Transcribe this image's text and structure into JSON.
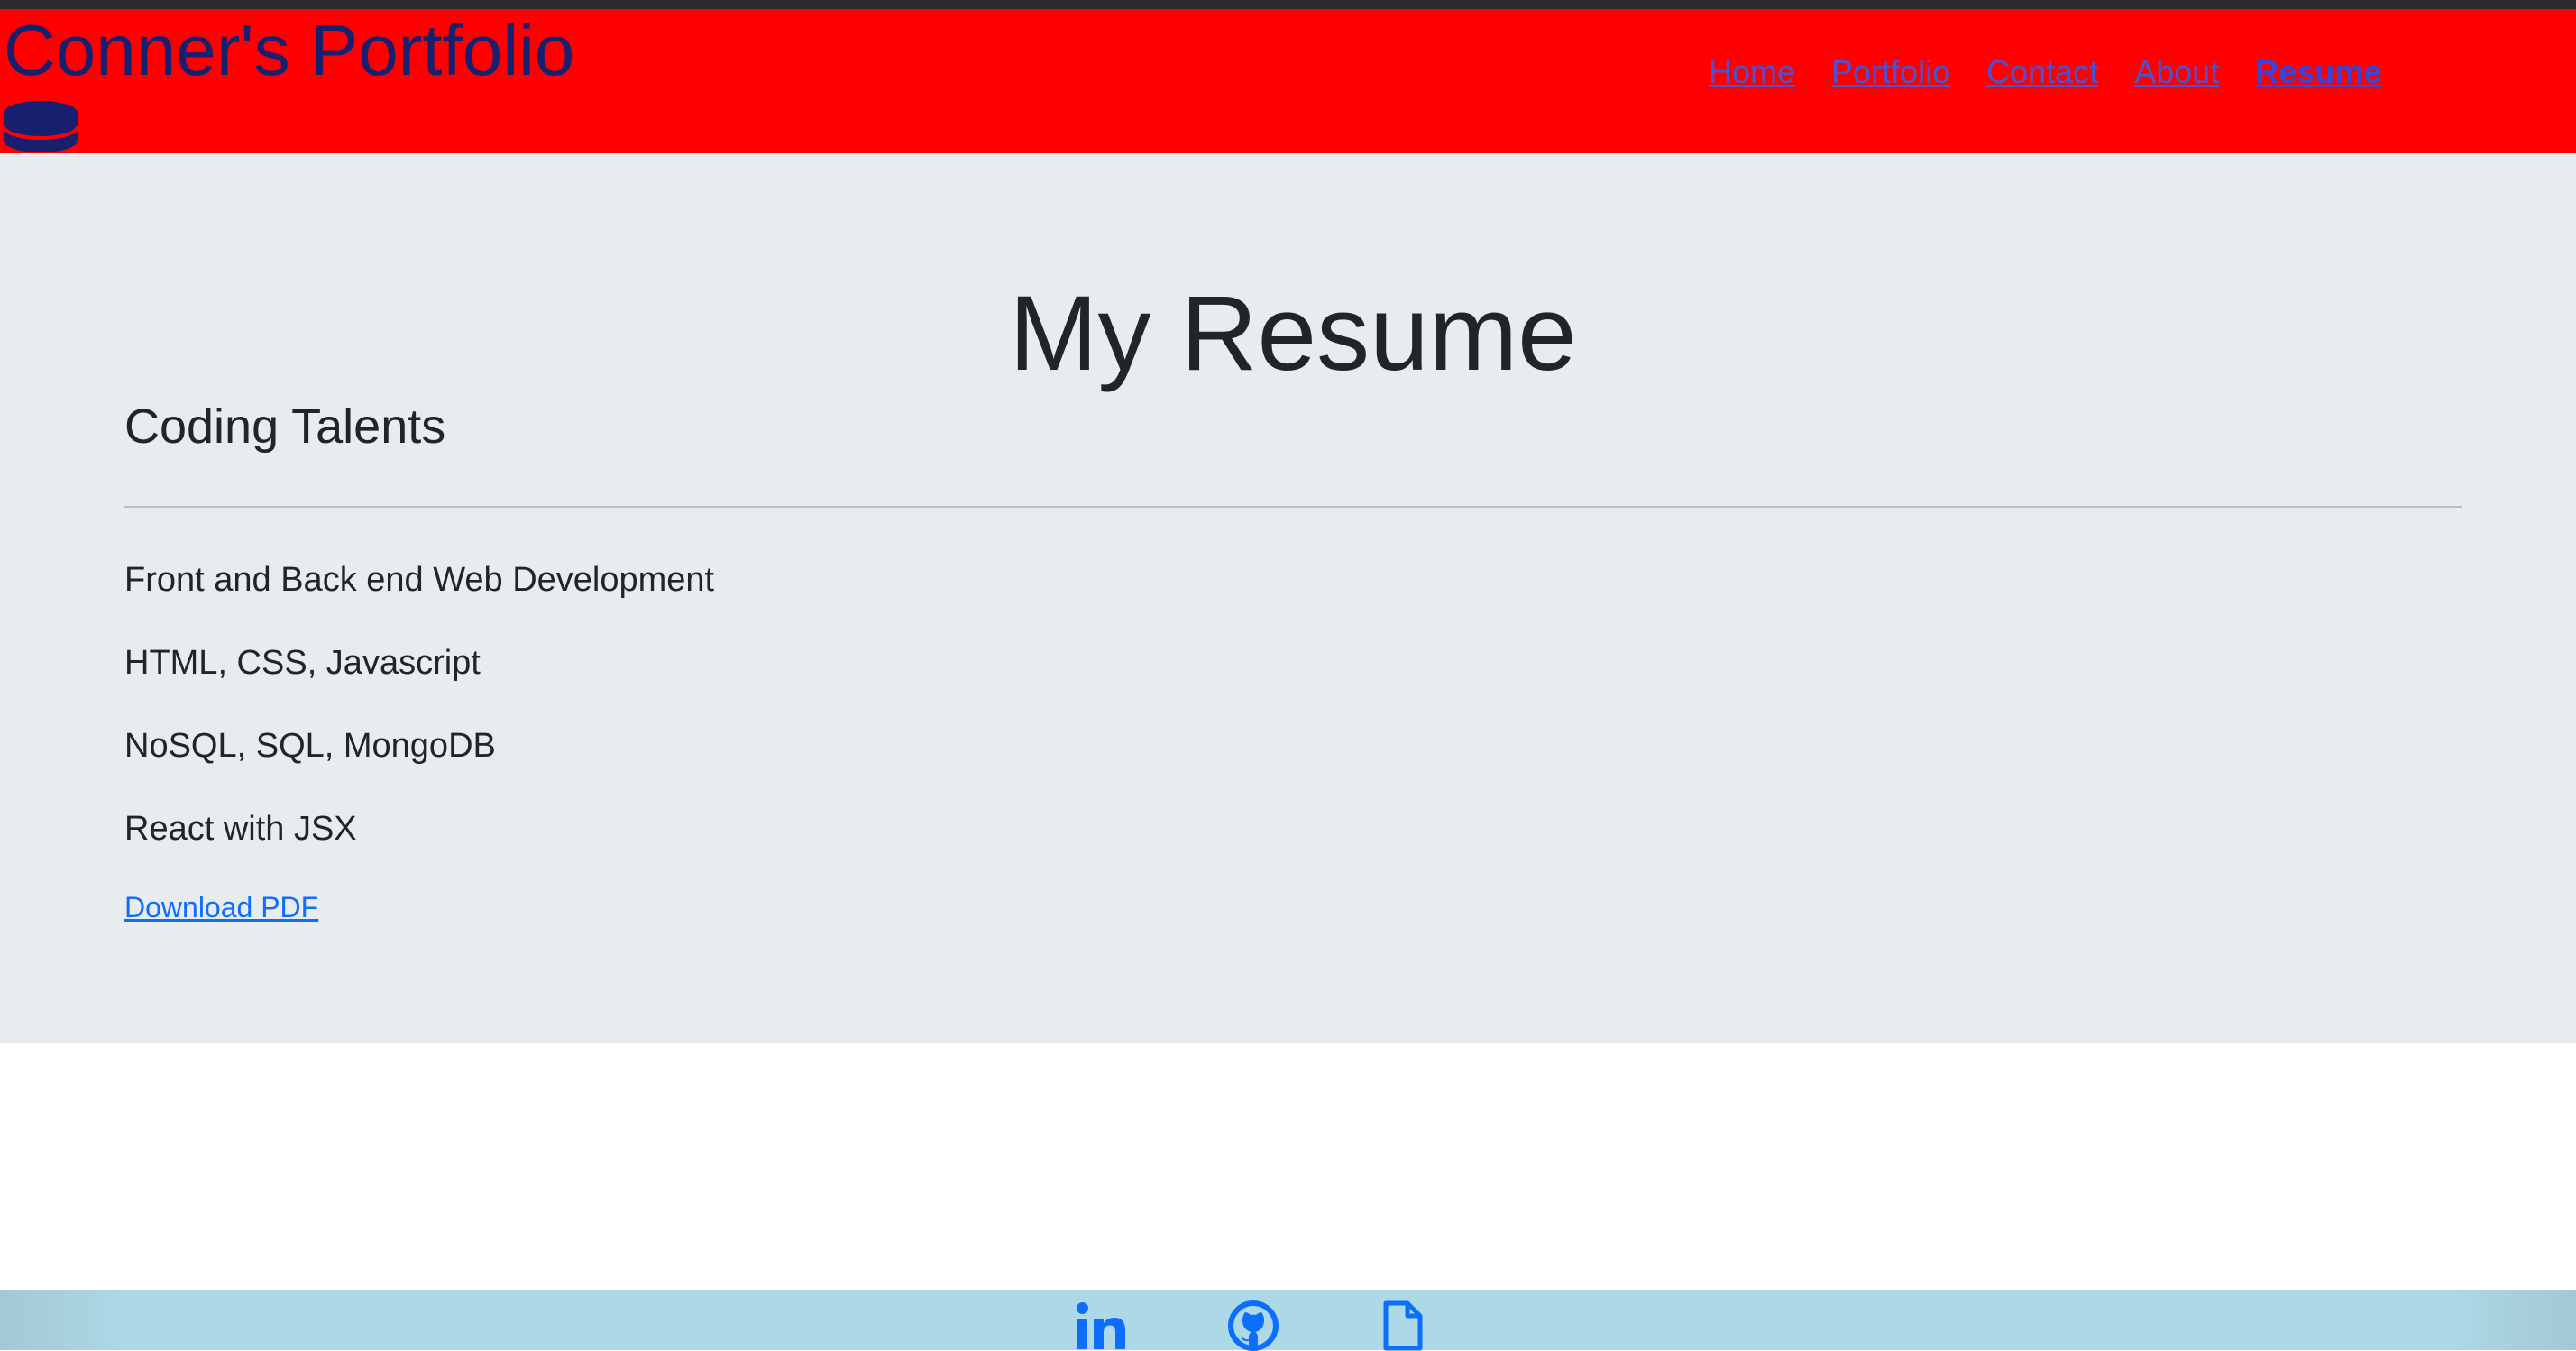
{
  "header": {
    "brand": "Conner's Portfolio",
    "brand_icon": "database-icon",
    "nav": [
      {
        "label": "Home",
        "active": false
      },
      {
        "label": "Portfolio",
        "active": false
      },
      {
        "label": "Contact",
        "active": false
      },
      {
        "label": "About",
        "active": false
      },
      {
        "label": "Resume",
        "active": true
      }
    ]
  },
  "main": {
    "title": "My Resume",
    "section_heading": "Coding Talents",
    "skills": [
      "Front and Back end Web Development",
      "HTML, CSS, Javascript",
      "NoSQL, SQL, MongoDB",
      "React with JSX"
    ],
    "download_label": "Download PDF"
  },
  "footer": {
    "icons": [
      "linkedin-icon",
      "github-icon",
      "file-icon"
    ]
  },
  "colors": {
    "header_bg": "#ff0000",
    "brand": "#17206e",
    "nav_link": "#4b52d4",
    "jumbotron_bg": "#e9ecef",
    "link": "#0d6efd",
    "footer_bg": "#add8e6"
  }
}
